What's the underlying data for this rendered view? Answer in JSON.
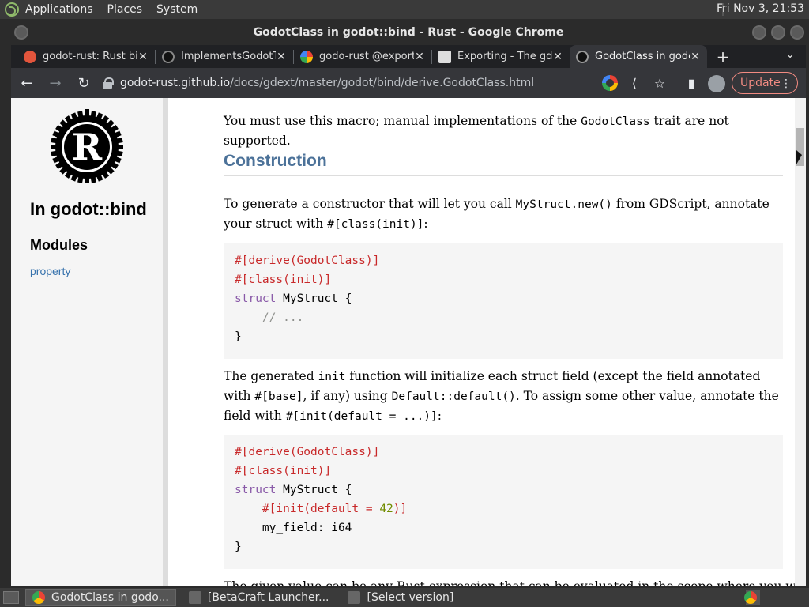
{
  "system_panel": {
    "menus": [
      "Applications",
      "Places",
      "System"
    ],
    "clock": "Fri Nov  3, 21:53"
  },
  "window": {
    "title": "GodotClass in godot::bind - Rust - Google Chrome"
  },
  "tabs": [
    {
      "label": "godot-rust: Rust bi",
      "favicon": "owl-icon",
      "active": false
    },
    {
      "label": "ImplementsGodotT",
      "favicon": "github-icon",
      "active": false
    },
    {
      "label": "godo-rust @export",
      "favicon": "google-icon",
      "active": false
    },
    {
      "label": "Exporting - The gdn",
      "favicon": "book-icon",
      "active": false
    },
    {
      "label": "GodotClass in godo",
      "favicon": "rust-icon",
      "active": true
    }
  ],
  "toolbar": {
    "url_host": "godot-rust.github.io",
    "url_path": "/docs/gdext/master/godot/bind/derive.GodotClass.html",
    "update_label": "Update"
  },
  "sidebar": {
    "crate_title": "In godot::bind",
    "modules_heading": "Modules",
    "module_links": [
      "property"
    ]
  },
  "doc": {
    "intro": {
      "t1": "You must use this macro; manual implementations of the ",
      "c1": "GodotClass",
      "t2": " trait are not supported."
    },
    "heading": "Construction",
    "para1": {
      "t1": "To generate a constructor that will let you call ",
      "c1": "MyStruct.new()",
      "t2": " from GDScript, annotate your struct with ",
      "c2": "#[class(init)]",
      "t3": ":"
    },
    "code1": {
      "l1": "#[derive(GodotClass)]",
      "l2": "#[class(init)]",
      "l3_kw": "struct",
      "l3_rest": " MyStruct {",
      "l4": "// ...",
      "l5": "}"
    },
    "para2": {
      "t1": "The generated ",
      "c1": "init",
      "t2": " function will initialize each struct field (except the field annotated with ",
      "c2": "#[base]",
      "t3": ", if any) using ",
      "c3": "Default::default()",
      "t4": ". To assign some other value, annotate the field with ",
      "c4": "#[init(default = ...)]",
      "t5": ":"
    },
    "code2": {
      "l1": "#[derive(GodotClass)]",
      "l2": "#[class(init)]",
      "l3_kw": "struct",
      "l3_rest": " MyStruct {",
      "l4_a": "#[init(default = ",
      "l4_num": "42",
      "l4_b": ")]",
      "l5": "my_field: i64",
      "l6": "}"
    },
    "para3_partial": "The given value can be any Rust expression that can be evaluated in the scope where you write the"
  },
  "taskbar": {
    "items": [
      {
        "label": "GodotClass in godo...",
        "active": true
      },
      {
        "label": "[BetaCraft Launcher...",
        "active": false
      },
      {
        "label": "[Select version]",
        "active": false
      }
    ]
  }
}
